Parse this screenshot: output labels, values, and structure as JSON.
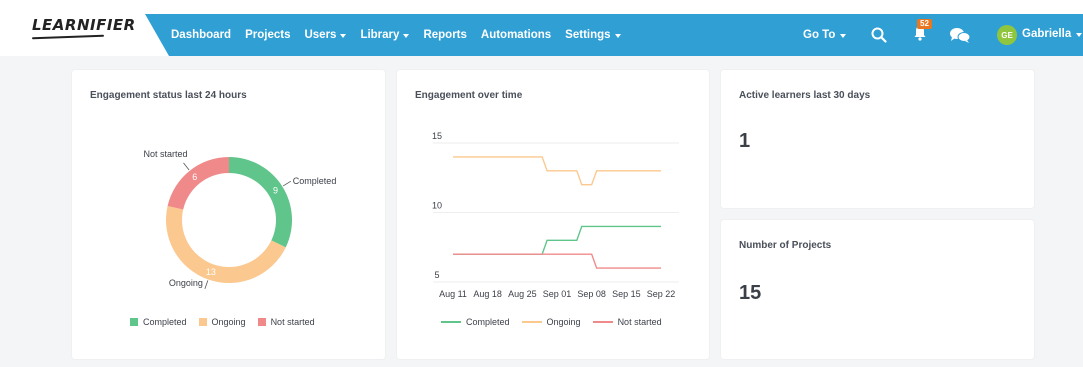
{
  "app": {
    "logo": "LEARNIFIER",
    "brand_color": "#2f9fd4"
  },
  "nav": {
    "items": [
      {
        "label": "Dashboard",
        "dropdown": false
      },
      {
        "label": "Projects",
        "dropdown": false
      },
      {
        "label": "Users",
        "dropdown": true
      },
      {
        "label": "Library",
        "dropdown": true
      },
      {
        "label": "Reports",
        "dropdown": false
      },
      {
        "label": "Automations",
        "dropdown": false
      },
      {
        "label": "Settings",
        "dropdown": true
      }
    ],
    "goto_label": "Go To",
    "notification_count": "52",
    "avatar_initials": "GE",
    "user_name": "Gabriella"
  },
  "cards": {
    "engagement_status": {
      "title": "Engagement status last 24 hours",
      "legend": [
        "Completed",
        "Ongoing",
        "Not started"
      ]
    },
    "engagement_time": {
      "title": "Engagement over time",
      "legend": [
        "Completed",
        "Ongoing",
        "Not started"
      ]
    },
    "active_learners": {
      "title": "Active learners last 30 days",
      "value": "1"
    },
    "projects": {
      "title": "Number of Projects",
      "value": "15"
    }
  },
  "chart_data": [
    {
      "type": "pie",
      "title": "Engagement status last 24 hours",
      "categories": [
        "Completed",
        "Ongoing",
        "Not started"
      ],
      "values": [
        9,
        13,
        6
      ],
      "colors": [
        "#5fc58a",
        "#fbc88f",
        "#f08a8a"
      ],
      "donut": true,
      "legend": "bottom"
    },
    {
      "type": "line",
      "title": "Engagement over time",
      "x": [
        "Aug 11",
        "Aug 18",
        "Aug 25",
        "Sep 01",
        "Sep 08",
        "Sep 15",
        "Sep 22"
      ],
      "ylim": [
        5,
        15
      ],
      "yticks": [
        5,
        10,
        15
      ],
      "grid": true,
      "legend": "bottom",
      "series": [
        {
          "name": "Completed",
          "color": "#5fc58a",
          "points": [
            [
              "Aug 11",
              7
            ],
            [
              "Aug 29",
              7
            ],
            [
              "Aug 30",
              8
            ],
            [
              "Sep 05",
              8
            ],
            [
              "Sep 06",
              9
            ],
            [
              "Sep 22",
              9
            ]
          ]
        },
        {
          "name": "Ongoing",
          "color": "#fbc88f",
          "points": [
            [
              "Aug 11",
              14
            ],
            [
              "Aug 29",
              14
            ],
            [
              "Aug 30",
              13
            ],
            [
              "Sep 05",
              13
            ],
            [
              "Sep 06",
              12
            ],
            [
              "Sep 08",
              12
            ],
            [
              "Sep 09",
              13
            ],
            [
              "Sep 22",
              13
            ]
          ]
        },
        {
          "name": "Not started",
          "color": "#f08a8a",
          "points": [
            [
              "Aug 11",
              7
            ],
            [
              "Sep 08",
              7
            ],
            [
              "Sep 09",
              6
            ],
            [
              "Sep 22",
              6
            ]
          ]
        }
      ]
    }
  ]
}
